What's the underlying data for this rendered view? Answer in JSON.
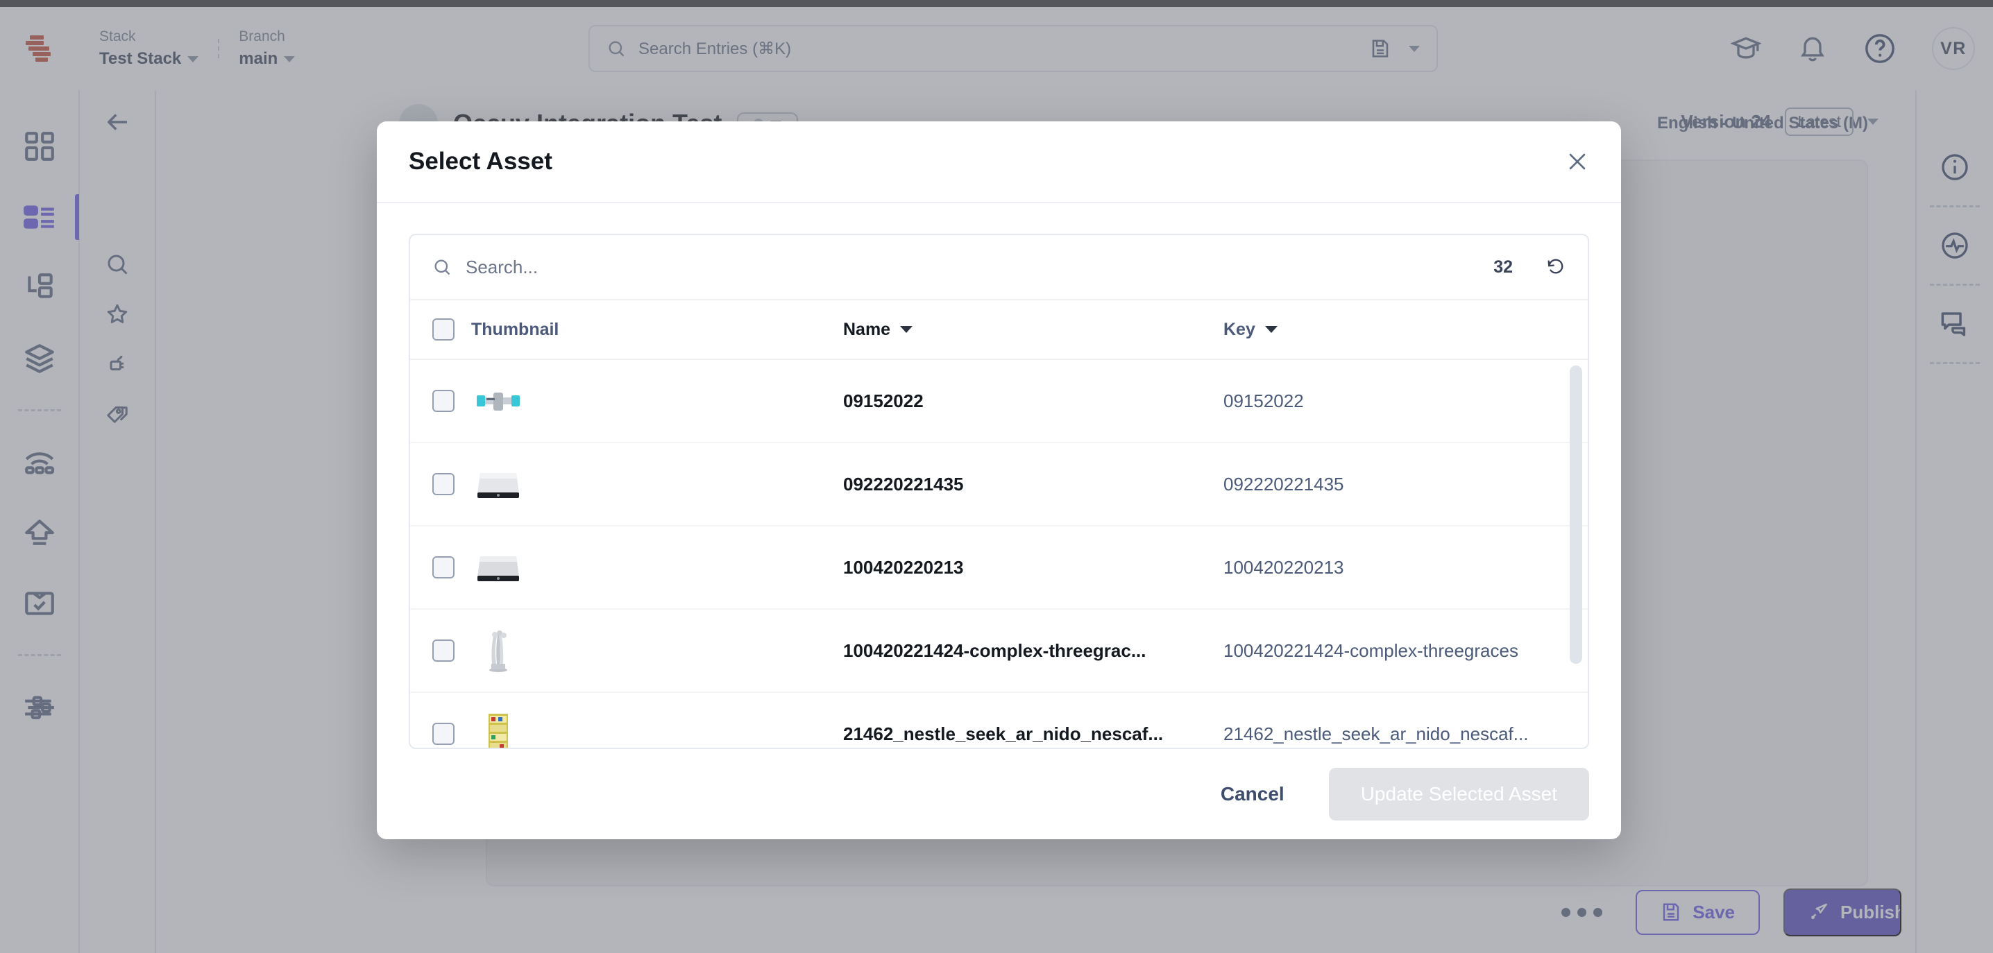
{
  "topnav": {
    "stack": {
      "label": "Stack",
      "value": "Test Stack"
    },
    "branch": {
      "label": "Branch",
      "value": "main"
    },
    "search_placeholder": "Search Entries (⌘K)",
    "avatar_initials": "VR"
  },
  "entry": {
    "title": "Occuv Integration Test",
    "locale": "English - United States (M)",
    "version_label": "Version 24",
    "version_chip": "Latest"
  },
  "bottombar": {
    "save_label": "Save",
    "publish_label": "Publish"
  },
  "modal": {
    "title": "Select Asset",
    "search_placeholder": "Search...",
    "count": "32",
    "columns": {
      "thumbnail": "Thumbnail",
      "name": "Name",
      "key": "Key"
    },
    "rows": [
      {
        "name": "09152022",
        "key": "09152022",
        "thumb": "valve-thumbnail"
      },
      {
        "name": "092220221435",
        "key": "092220221435",
        "thumb": "device-thumbnail"
      },
      {
        "name": "100420220213",
        "key": "100420220213",
        "thumb": "device-thumbnail"
      },
      {
        "name": "100420221424-complex-threegrac...",
        "key": "100420221424-complex-threegraces",
        "thumb": "statue-thumbnail"
      },
      {
        "name": "21462_nestle_seek_ar_nido_nescaf...",
        "key": "21462_nestle_seek_ar_nido_nescaf...",
        "thumb": "shelf-thumbnail"
      }
    ],
    "cancel_label": "Cancel",
    "update_label": "Update Selected Asset"
  },
  "colors": {
    "accent": "#6c5ce7",
    "publish": "#5b51c4",
    "brand_logo": "#c8503c",
    "text_dark": "#14181f",
    "text_muted": "#4b5a7a"
  }
}
